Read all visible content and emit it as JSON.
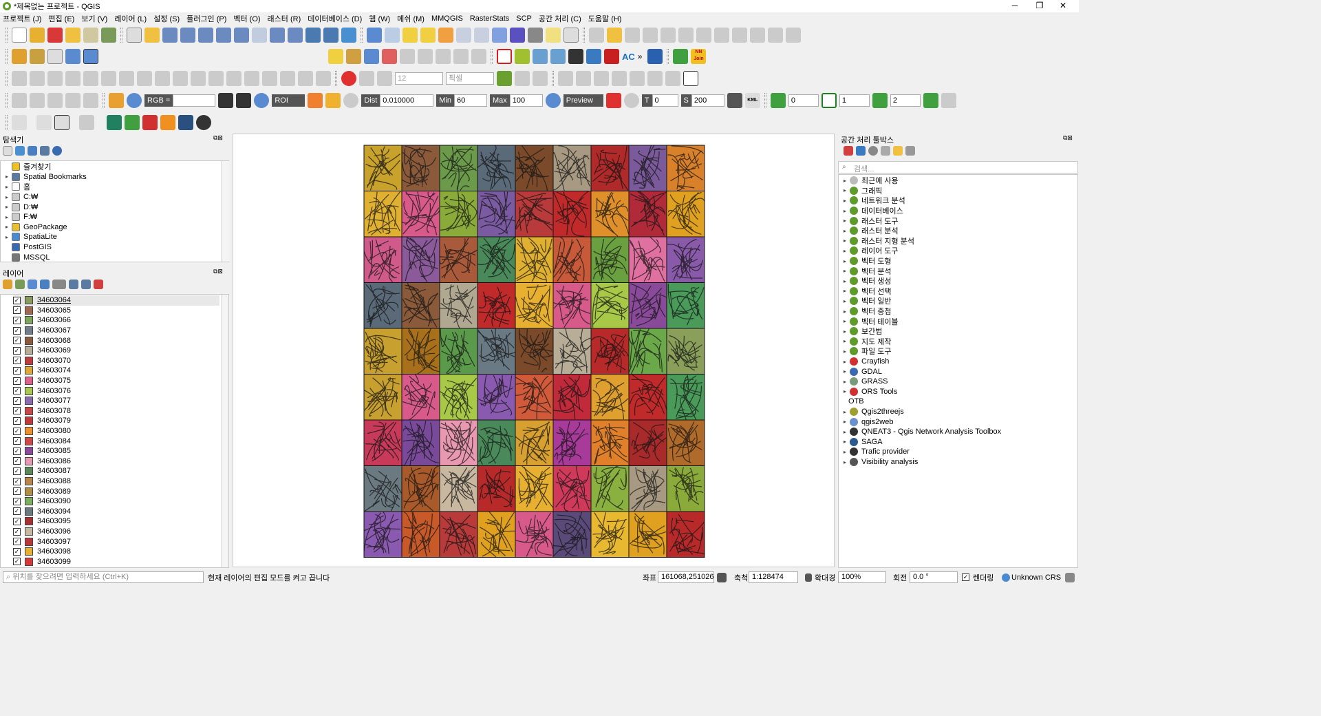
{
  "window": {
    "title": "*제목없는 프로젝트 - QGIS",
    "minimize": "─",
    "maximize": "❐",
    "close": "✕"
  },
  "menu": [
    "프로젝트 (J)",
    "편집 (E)",
    "보기 (V)",
    "레이어 (L)",
    "설정 (S)",
    "플러그인 (P)",
    "벡터 (O)",
    "래스터 (R)",
    "데이터베이스 (D)",
    "웹 (W)",
    "메쉬 (M)",
    "MMQGIS",
    "RasterStats",
    "SCP",
    "공간 처리 (C)",
    "도움말 (H)"
  ],
  "toolbar": {
    "snap_tolerance": "12",
    "snap_unit": "픽셀",
    "scp": {
      "rgb_label": "RGB =",
      "rgb_value": "",
      "roi_label": "ROI",
      "dist_label": "Dist",
      "dist_value": "0.010000",
      "min_label": "Min",
      "min_value": "60",
      "max_label": "Max",
      "max_value": "100",
      "preview_label": "Preview",
      "t_label": "T",
      "t_value": "0",
      "s_label": "S",
      "s_value": "200",
      "kml_label": "KML",
      "band_values": [
        "0",
        "1",
        "2"
      ]
    },
    "nn_join_label": "NN Join",
    "ac_label": "AC"
  },
  "browser": {
    "title": "탐색기",
    "items": [
      "즐겨찾기",
      "Spatial Bookmarks",
      "홈",
      "C:₩",
      "D:₩",
      "F:₩",
      "GeoPackage",
      "SpatiaLite",
      "PostGIS",
      "MSSQL"
    ]
  },
  "layers": {
    "title": "레이어",
    "items": [
      {
        "name": "34603064",
        "color": "#8a9a5b"
      },
      {
        "name": "34603065",
        "color": "#a0684f"
      },
      {
        "name": "34603066",
        "color": "#7fa65a"
      },
      {
        "name": "34603067",
        "color": "#6f7e8a"
      },
      {
        "name": "34603068",
        "color": "#8a5a3a"
      },
      {
        "name": "34603069",
        "color": "#b8ad94"
      },
      {
        "name": "34603070",
        "color": "#c23b3b"
      },
      {
        "name": "34603074",
        "color": "#e0a830"
      },
      {
        "name": "34603075",
        "color": "#e0608a"
      },
      {
        "name": "34603076",
        "color": "#a8c850"
      },
      {
        "name": "34603077",
        "color": "#8a6ab0"
      },
      {
        "name": "34603078",
        "color": "#c84848"
      },
      {
        "name": "34603079",
        "color": "#c03a3a"
      },
      {
        "name": "34603080",
        "color": "#f0902a"
      },
      {
        "name": "34603084",
        "color": "#d04848"
      },
      {
        "name": "34603085",
        "color": "#8a4a9a"
      },
      {
        "name": "34603086",
        "color": "#e898b0"
      },
      {
        "name": "34603087",
        "color": "#5a8a5a"
      },
      {
        "name": "34603088",
        "color": "#b8864a"
      },
      {
        "name": "34603089",
        "color": "#b09040"
      },
      {
        "name": "34603090",
        "color": "#7ab05a"
      },
      {
        "name": "34603094",
        "color": "#6a7a80"
      },
      {
        "name": "34603095",
        "color": "#a83030"
      },
      {
        "name": "34603096",
        "color": "#c8b8a0"
      },
      {
        "name": "34603097",
        "color": "#b83838"
      },
      {
        "name": "34603098",
        "color": "#e8b030"
      },
      {
        "name": "34603099",
        "color": "#d83838"
      }
    ]
  },
  "processing": {
    "title": "공간 처리 툴박스",
    "search_placeholder": "검색...",
    "items": [
      "최근에 사용",
      "그래픽",
      "네트워크 분석",
      "데이터베이스",
      "래스터 도구",
      "래스터 분석",
      "래스터 지형 분석",
      "레이어 도구",
      "벡터 도형",
      "벡터 분석",
      "벡터 생성",
      "벡터 선택",
      "벡터 일반",
      "벡터 중첩",
      "벡터 테이블",
      "보간법",
      "지도 제작",
      "파일 도구",
      "Crayfish",
      "GDAL",
      "GRASS",
      "ORS Tools",
      "OTB",
      "Qgis2threejs",
      "qgis2web",
      "QNEAT3 - Qgis Network Analysis Toolbox",
      "SAGA",
      "Trafic provider",
      "Visibility analysis"
    ]
  },
  "status": {
    "locator_placeholder": "위치를 찾으려면 입력하세요 (Ctrl+K)",
    "message": "현재 레이어의 편집 모드를 켜고 끕니다",
    "coord_label": "좌표",
    "coord_value": "161068,251026",
    "scale_label": "축척",
    "scale_value": "1:128474",
    "magnifier_label": "확대경",
    "magnifier_value": "100%",
    "rotation_label": "회전",
    "rotation_value": "0.0 °",
    "render_label": "렌더링",
    "crs_label": "Unknown CRS"
  },
  "map": {
    "tile_colors": [
      [
        "#c9a22c",
        "#8a5a3a",
        "#6a9a4a",
        "#5a6a78",
        "#7a4a2a",
        "#a89a82",
        "#b02a2a",
        "#7a5a9a",
        "#d8802a"
      ],
      [
        "#e0b030",
        "#d85a8a",
        "#8aaa3a",
        "#7a5aa0",
        "#b83a3a",
        "#c02a2a",
        "#e0902a",
        "#b02a3a",
        "#e0a020"
      ],
      [
        "#d05a8a",
        "#8a5a9a",
        "#a85a3a",
        "#4a8a5a",
        "#e0b030",
        "#c85a3a",
        "#6aa040",
        "#e070a0",
        "#8a5aaa"
      ],
      [
        "#5a6a78",
        "#8a5a3a",
        "#b0a890",
        "#c02a2a",
        "#e8b030",
        "#d85a8a",
        "#a8c848",
        "#8a4a9a",
        "#4a9a5a"
      ],
      [
        "#c8a030",
        "#a8701a",
        "#5a9a4a",
        "#6a7a84",
        "#7a4a2a",
        "#b8ae98",
        "#b82a2a",
        "#6aa84a",
        "#8aa05a"
      ],
      [
        "#c8a030",
        "#d85a8a",
        "#a8c848",
        "#8a5ab0",
        "#d05a3a",
        "#c02a3a",
        "#e0a030",
        "#c02a2a",
        "#4a9a5a"
      ],
      [
        "#c83a5a",
        "#7a4a9a",
        "#e898b0",
        "#4a8a5a",
        "#d8a030",
        "#a83a9a",
        "#e0802a",
        "#a82a2a",
        "#b06a2a"
      ],
      [
        "#6a7a80",
        "#a85a2a",
        "#c8b8a0",
        "#b82a2a",
        "#e8b030",
        "#d03a5a",
        "#8ab040",
        "#a89a82",
        "#8aaa3a"
      ],
      [
        "#8a5ab0",
        "#c85a2a",
        "#b83a3a",
        "#e0a020",
        "#d85a8a",
        "#5a4a7a",
        "#e8b830",
        "#e0a020",
        "#b82a2a"
      ]
    ]
  }
}
